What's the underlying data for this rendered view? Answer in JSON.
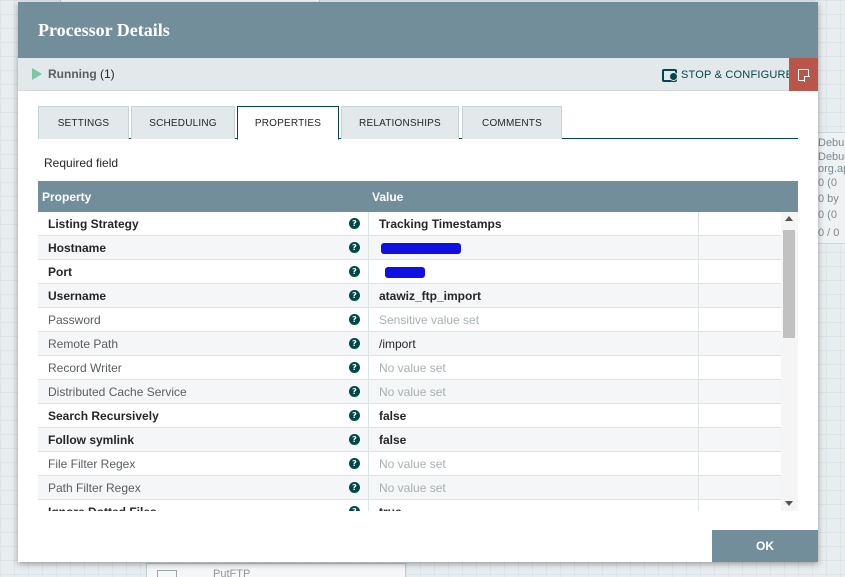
{
  "dialog": {
    "title": "Processor Details"
  },
  "status": {
    "state": "Running",
    "count": "(1)",
    "stop_configure_label": "STOP & CONFIGURE"
  },
  "tabs": [
    {
      "label": "SETTINGS",
      "active": false
    },
    {
      "label": "SCHEDULING",
      "active": false
    },
    {
      "label": "PROPERTIES",
      "active": true
    },
    {
      "label": "RELATIONSHIPS",
      "active": false
    },
    {
      "label": "COMMENTS",
      "active": false
    }
  ],
  "required_field_label": "Required field",
  "table": {
    "headers": {
      "property": "Property",
      "value": "Value"
    },
    "rows": [
      {
        "property": "Listing Strategy",
        "required": true,
        "value": "Tracking Timestamps",
        "value_state": "set"
      },
      {
        "property": "Hostname",
        "required": true,
        "value": "",
        "value_state": "redacted"
      },
      {
        "property": "Port",
        "required": true,
        "value": "",
        "value_state": "redacted"
      },
      {
        "property": "Username",
        "required": true,
        "value": "atawiz_ftp_import",
        "value_state": "set"
      },
      {
        "property": "Password",
        "required": false,
        "value": "Sensitive value set",
        "value_state": "unset"
      },
      {
        "property": "Remote Path",
        "required": false,
        "value": "/import",
        "value_state": "plain"
      },
      {
        "property": "Record Writer",
        "required": false,
        "value": "No value set",
        "value_state": "unset"
      },
      {
        "property": "Distributed Cache Service",
        "required": false,
        "value": "No value set",
        "value_state": "unset"
      },
      {
        "property": "Search Recursively",
        "required": true,
        "value": "false",
        "value_state": "set"
      },
      {
        "property": "Follow symlink",
        "required": true,
        "value": "false",
        "value_state": "set"
      },
      {
        "property": "File Filter Regex",
        "required": false,
        "value": "No value set",
        "value_state": "unset"
      },
      {
        "property": "Path Filter Regex",
        "required": false,
        "value": "No value set",
        "value_state": "unset"
      },
      {
        "property": "Ignore Dotted Files",
        "required": true,
        "value": "true",
        "value_state": "set"
      }
    ]
  },
  "ok_label": "OK",
  "background": {
    "right_card_lines": [
      "Debu",
      "Debug",
      "org.apa",
      "0 (0",
      "0 by",
      "0 (0",
      "0 / 0"
    ],
    "bottom_card_text": "PutFTP"
  },
  "colors": {
    "header": "#728e9b",
    "accent": "#004849",
    "running": "#7dc7a0",
    "note_button": "#ba554a",
    "redaction": "#1010e0"
  },
  "icons": {
    "running": "play-icon",
    "stop_configure": "stop-configure-icon",
    "note": "note-icon",
    "help": "help-icon"
  }
}
